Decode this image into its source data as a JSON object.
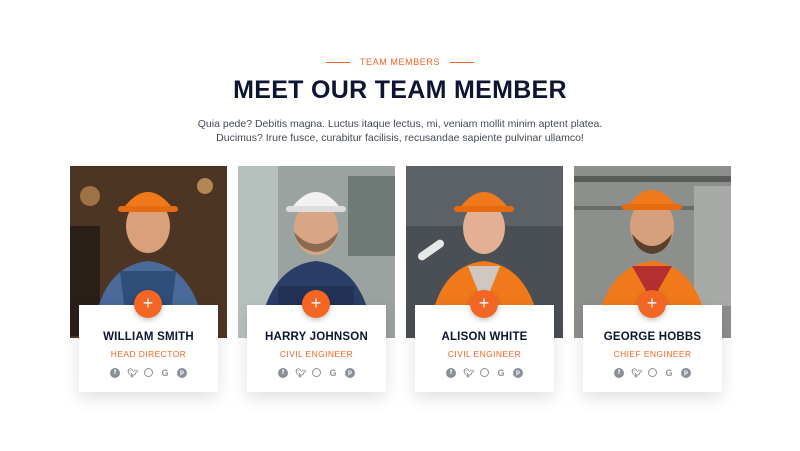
{
  "section": {
    "eyebrow": "TEAM MEMBERS",
    "title": "MEET OUR TEAM MEMBER",
    "description_line1": "Quia pede? Debitis magna. Luctus itaque lectus, mi, veniam mollit minim aptent platea.",
    "description_line2": "Ducimus? Irure fusce, curabitur facilisis, recusandae sapiente pulvinar ullamco!"
  },
  "accent_color": "#f26522",
  "members": [
    {
      "name": "WILLIAM SMITH",
      "role": "HEAD DIRECTOR",
      "helmet": "orange"
    },
    {
      "name": "HARRY JOHNSON",
      "role": "CIVIL ENGINEER",
      "helmet": "white"
    },
    {
      "name": "ALISON WHITE",
      "role": "CIVIL ENGINEER",
      "helmet": "orange"
    },
    {
      "name": "GEORGE HOBBS",
      "role": "CHIEF ENGINEER",
      "helmet": "orange"
    }
  ],
  "plus_label": "+",
  "social_icons": [
    "facebook-icon",
    "twitter-icon",
    "instagram-icon",
    "google-icon",
    "pinterest-icon"
  ]
}
